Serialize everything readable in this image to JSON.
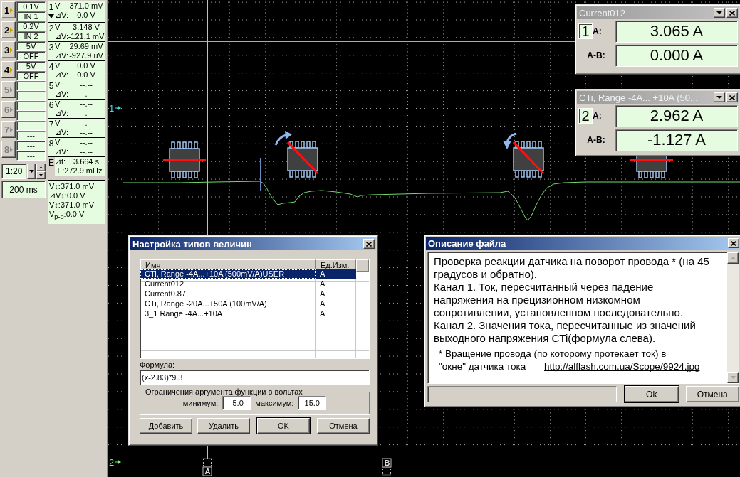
{
  "channels": [
    {
      "number": "1",
      "range": "0.1V",
      "input": "IN 1",
      "enabled": true
    },
    {
      "number": "2",
      "range": "0.2V",
      "input": "IN 2",
      "enabled": true
    },
    {
      "number": "3",
      "range": "5V",
      "input": "OFF",
      "enabled": true
    },
    {
      "number": "4",
      "range": "5V",
      "input": "OFF",
      "enabled": true
    },
    {
      "number": "5",
      "range": "---",
      "input": "---",
      "enabled": false
    },
    {
      "number": "6",
      "range": "---",
      "input": "---",
      "enabled": false
    },
    {
      "number": "7",
      "range": "---",
      "input": "---",
      "enabled": false
    },
    {
      "number": "8",
      "range": "---",
      "input": "---",
      "enabled": false
    }
  ],
  "timebase": {
    "zoom": "1:20",
    "time_per_div": "200 ms"
  },
  "readings": [
    {
      "number": "1",
      "selected": true,
      "v_label": "V:",
      "v": "371.0 mV",
      "dv_label": "⊿V:",
      "dv": "0.0 V"
    },
    {
      "number": "2",
      "selected": false,
      "v_label": "V:",
      "v": "3.148 V",
      "dv_label": "⊿V:",
      "dv": "-121.1 mV"
    },
    {
      "number": "3",
      "selected": false,
      "v_label": "V:",
      "v": "29.69 mV",
      "dv_label": "⊿V:",
      "dv": "-927.9 uV"
    },
    {
      "number": "4",
      "selected": false,
      "v_label": "V:",
      "v": "0.0 V",
      "dv_label": "⊿V:",
      "dv": "0.0 V"
    },
    {
      "number": "5",
      "selected": false,
      "v_label": "V:",
      "v": "--.--",
      "dv_label": "⊿V:",
      "dv": "--.--"
    },
    {
      "number": "6",
      "selected": false,
      "v_label": "V:",
      "v": "--.--",
      "dv_label": "⊿V:",
      "dv": "--.--"
    },
    {
      "number": "7",
      "selected": false,
      "v_label": "V:",
      "v": "--.--",
      "dv_label": "⊿V:",
      "dv": "--.--"
    },
    {
      "number": "8",
      "selected": false,
      "v_label": "V:",
      "v": "--.--",
      "dv_label": "⊿V:",
      "dv": "--.--"
    }
  ],
  "period": {
    "label": "E",
    "dt_label": "⊿t:",
    "dt": "3.664 s",
    "frequency": "F:272.9 mHz"
  },
  "cursor_readings": [
    "V↕:371.0 mV",
    "⊿V↕:0.0 V",
    "V↕:371.0 mV",
    "V$_{p-p}$:0.0 V"
  ],
  "scope": {
    "channel_markers": [
      {
        "label": "1",
        "color": "#40d8e8"
      },
      {
        "label": "2",
        "color": "#80f080"
      }
    ],
    "cursors": [
      {
        "label": "A"
      },
      {
        "label": "B"
      }
    ]
  },
  "meters": [
    {
      "title": "Current012",
      "active": false,
      "channel": "1",
      "a_label": "A:",
      "a_value": "3.065 A",
      "ab_label": "A-B:",
      "ab_value": "0.000 A"
    },
    {
      "title": "CTi, Range -4A... +10A (50...",
      "active": false,
      "channel": "2",
      "a_label": "A:",
      "a_value": "2.962 A",
      "ab_label": "A-B:",
      "ab_value": "-1.127 A"
    }
  ],
  "types_dialog": {
    "title": "Настройка типов величин",
    "active": true,
    "columns": [
      "Имя",
      "Ед.Изм."
    ],
    "rows": [
      {
        "name": "CTi, Range -4A...+10A (500mV/A)USER",
        "unit": "A",
        "selected": true
      },
      {
        "name": "Current012",
        "unit": "A",
        "selected": false
      },
      {
        "name": "Current0.87",
        "unit": "A",
        "selected": false
      },
      {
        "name": "CTi, Range -20A...+50A (100mV/A)",
        "unit": "A",
        "selected": false
      },
      {
        "name": "3_1 Range -4A...+10A",
        "unit": "A",
        "selected": false
      }
    ],
    "formula_label": "Формула:",
    "formula": "(x-2.83)*9.3",
    "limits_title": "Ограничения аргумента функции в вольтах",
    "min_label": "минимум:",
    "min": "-5.0",
    "max_label": "максимум:",
    "max": "15.0",
    "buttons": [
      {
        "label": "Добавить",
        "default": false
      },
      {
        "label": "Удалить",
        "default": false
      },
      {
        "label": "OK",
        "default": true
      },
      {
        "label": "Отмена",
        "default": false
      }
    ]
  },
  "description_dialog": {
    "title": "Описание файла",
    "active": true,
    "paragraphs": [
      "Проверка реакции датчика на поворот провода * (на 45\nградусов и обратно).",
      "Канал 1. Ток, пересчитанный через падение\nнапряжения на прецизионном низкомном\nсопротивлении, установленном последовательно.",
      "Канал 2. Значения тока, пересчитанные из значений\nвыходного напряжения CTi(формула слева)."
    ],
    "footnote": "* Вращение провода (по которому протекает ток) в\n\"окне\" датчика тока ",
    "link": "http://alflash.com.ua/Scope/9924.jpg",
    "buttons": [
      {
        "label": "Ok",
        "default": true
      },
      {
        "label": "Отмена",
        "default": false
      }
    ]
  }
}
